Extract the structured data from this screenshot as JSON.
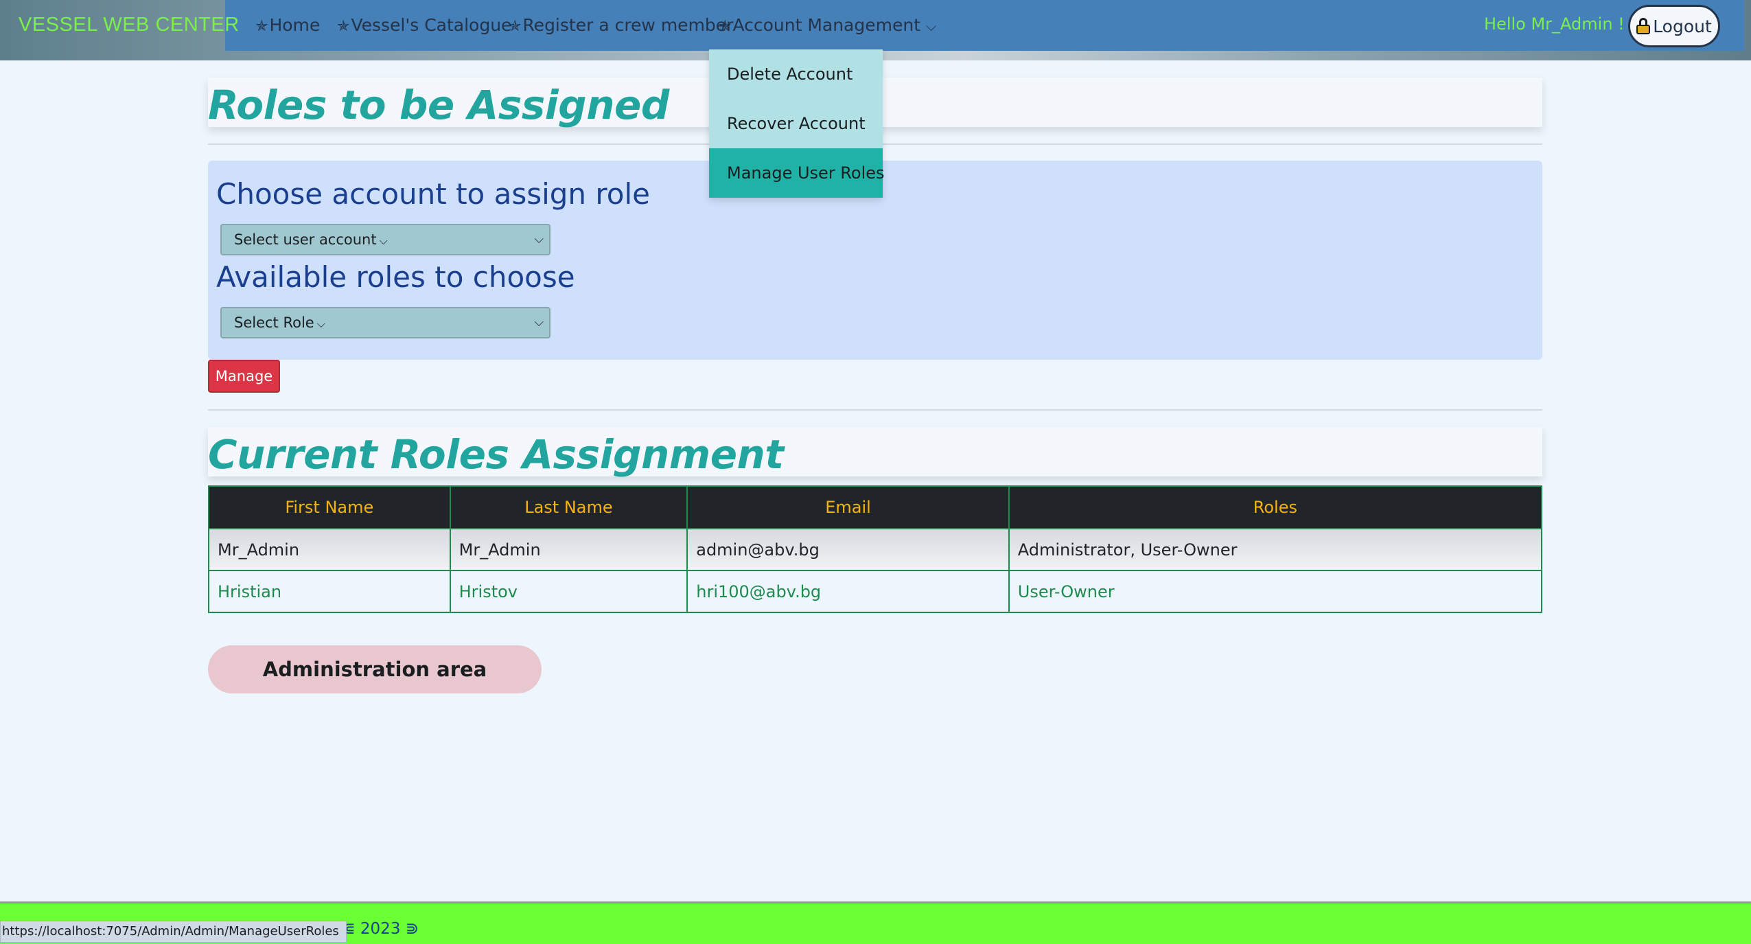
{
  "nav": {
    "brand": "VESSEL WEB CENTER",
    "star": "✯",
    "links": [
      "Home",
      "Vessel's Catalogue",
      "Register a crew member",
      "Account Management"
    ],
    "dropdown_chevron": "⌵",
    "greeting": "Hello Mr_Admin !",
    "logout_label": "Logout"
  },
  "dropdown": {
    "items": [
      "Delete Account",
      "Recover Account",
      "Manage User Roles"
    ],
    "active_index": 2
  },
  "assign": {
    "title": "Roles to be Assigned",
    "account_heading": "Choose account to assign role",
    "account_select": "Select user account",
    "roles_heading": "Available roles to choose",
    "role_select": "Select Role",
    "manage_button": "Manage"
  },
  "current": {
    "title": "Current Roles Assignment",
    "columns": [
      "First Name",
      "Last Name",
      "Email",
      "Roles"
    ],
    "rows": [
      [
        "Mr_Admin",
        "Mr_Admin",
        "admin@abv.bg",
        "Administrator, User-Owner"
      ],
      [
        "Hristian",
        "Hristov",
        "hri100@abv.bg",
        "User-Owner"
      ]
    ]
  },
  "admin_area_label": "Administration area",
  "footer": {
    "text": "Center - ⋐ 2023 ⋑"
  },
  "status_bar_url": "https://localhost:7075/Admin/Admin/ManageUserRoles",
  "colors": {
    "nav_band": "#4680b9",
    "brand": "#7cf04a",
    "title": "#22a59f",
    "heading": "#1a3f8f",
    "manage_button": "#dc3545",
    "table_header_text": "#f6b30d",
    "footer": "#6bff35"
  }
}
